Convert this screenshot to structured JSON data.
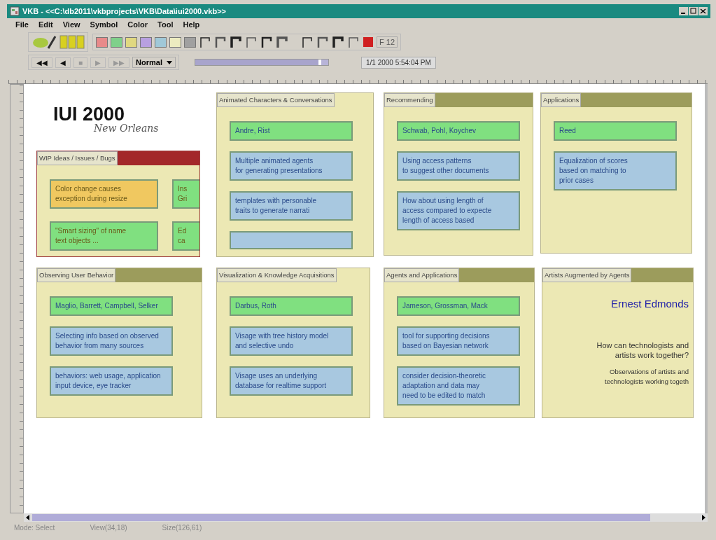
{
  "window": {
    "title": "VKB - <<C:\\db2011\\vkbprojects\\VKB\\Data\\iui2000.vkb>>"
  },
  "menu": [
    "File",
    "Edit",
    "View",
    "Symbol",
    "Color",
    "Tool",
    "Help"
  ],
  "swatches": [
    {
      "color": "#e88a8a"
    },
    {
      "color": "#7fd08a"
    },
    {
      "color": "#e0d880"
    },
    {
      "color": "#b8a0e0"
    },
    {
      "color": "#a0c8d8"
    },
    {
      "color": "#ecebc0"
    },
    {
      "color": "#a0a0a0"
    }
  ],
  "font_size": "F 12",
  "playback": [
    {
      "label": "◀◀",
      "disabled": false
    },
    {
      "label": "◀",
      "disabled": false
    },
    {
      "label": "■",
      "disabled": true
    },
    {
      "label": "▶",
      "disabled": true
    },
    {
      "label": "▶▶",
      "disabled": true
    }
  ],
  "speed": {
    "value": "Normal"
  },
  "timeline": {
    "level": 0.95
  },
  "timestamp": "1/1 2000 5:54:04 PM",
  "canvas": {
    "title": "IUI 2000",
    "subtitle": "New Orleans",
    "cards": [
      {
        "kind": "grid",
        "title": "WIP Ideas / Issues / Bugs",
        "color": "#a3282a",
        "items": [
          {
            "color": "#f0c860",
            "lines": [
              "Color change causes",
              "exception during resize"
            ]
          },
          {
            "color": "#80e080",
            "lines": [
              "Ins",
              "Gri"
            ]
          },
          {
            "color": "#80e080",
            "lines": [
              "\"Smart sizing\" of name",
              "text objects ..."
            ]
          },
          {
            "color": "#80e080",
            "lines": [
              "Ed",
              "ca"
            ]
          }
        ]
      },
      {
        "kind": "stack",
        "title": "Animated Characters & Conversations",
        "items": [
          {
            "color": "#80e080",
            "lines": [
              "Andre, Rist"
            ]
          },
          {
            "color": "#a8c8e0",
            "lines": [
              "Multiple animated agents",
              "for generating presentations"
            ]
          },
          {
            "color": "#a8c8e0",
            "lines": [
              "templates with personable",
              "traits to generate narrati"
            ]
          },
          {
            "color": "#a8c8e0"
          }
        ]
      },
      {
        "kind": "stack",
        "title": "Recommending",
        "color": "#9c9c5c",
        "items": [
          {
            "color": "#80e080",
            "lines": [
              "Schwab, Pohl, Koychev"
            ]
          },
          {
            "color": "#a8c8e0",
            "lines": [
              "Using access patterns",
              "to suggest other documents"
            ]
          },
          {
            "color": "#a8c8e0",
            "lines": [
              "How about using length of",
              "access compared to expecte",
              "length of access based"
            ]
          }
        ]
      },
      {
        "kind": "stack",
        "title": "Applications",
        "color": "#9c9c5c",
        "items": [
          {
            "color": "#80e080",
            "lines": [
              "Reed"
            ]
          },
          {
            "color": "#a8c8e0",
            "lines": [
              "Equalization of scores",
              "based on matching to",
              "prior cases"
            ]
          }
        ]
      },
      {
        "kind": "stack",
        "title": "Observing User Behavior",
        "color": "#9c9c5c",
        "items": [
          {
            "color": "#80e080",
            "lines": [
              "Maglio, Barrett, Campbell, Selker"
            ]
          },
          {
            "color": "#a8c8e0",
            "lines": [
              "Selecting info based on observed",
              "behavior from many sources"
            ]
          },
          {
            "color": "#a8c8e0",
            "lines": [
              "behaviors: web usage, application",
              "input device, eye tracker"
            ]
          }
        ]
      },
      {
        "kind": "stack",
        "title": "Visualization & Knowledge Acquisitions",
        "items": [
          {
            "color": "#80e080",
            "lines": [
              "Darbus, Roth"
            ]
          },
          {
            "color": "#a8c8e0",
            "lines": [
              "Visage with tree history model",
              "and selective undo"
            ]
          },
          {
            "color": "#a8c8e0",
            "lines": [
              "Visage uses an underlying",
              "database for realtime support"
            ]
          }
        ]
      },
      {
        "kind": "stack",
        "title": "Agents and Applications",
        "color": "#9c9c5c",
        "items": [
          {
            "color": "#80e080",
            "lines": [
              "Jameson, Grossman, Mack"
            ]
          },
          {
            "color": "#a8c8e0",
            "lines": [
              "tool for supporting decisions",
              "based on Bayesian network"
            ]
          },
          {
            "color": "#a8c8e0",
            "lines": [
              "consider decision-theoretic",
              "adaptation and data may",
              "need to be edited to match"
            ]
          }
        ]
      },
      {
        "kind": "text",
        "title": "Artists Augmented by Agents",
        "color": "#9c9c5c",
        "speaker": "Ernest Edmonds",
        "question": [
          "How can technologists and",
          "artists work together?"
        ],
        "note": [
          "Observations of artists and",
          "technologists working togeth"
        ]
      }
    ]
  },
  "status_bar": [
    "Mode: Select",
    "View(34,18)",
    "Size(126,61)"
  ]
}
